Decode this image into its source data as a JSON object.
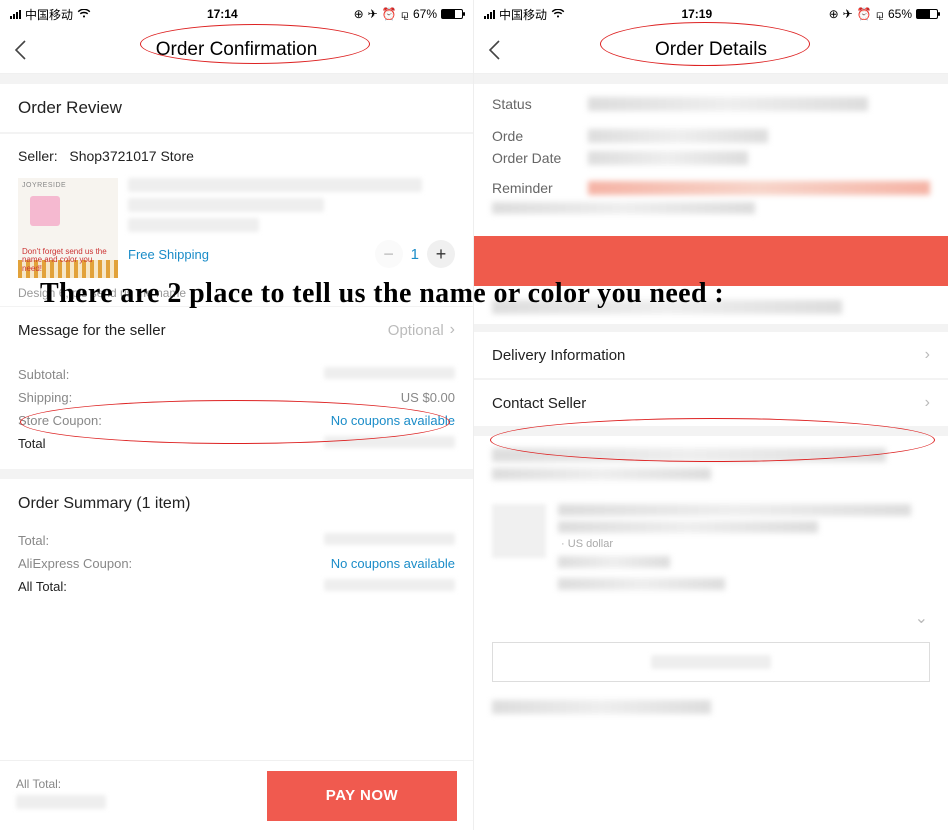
{
  "overlay_text": "There are 2 place to tell us the name or color you need :",
  "left": {
    "status": {
      "carrier": "中国移动",
      "time": "17:14",
      "battery_pct": "67%",
      "battery_fill": 67
    },
    "nav_title": "Order Confirmation",
    "review_title": "Order Review",
    "seller_label": "Seller:",
    "seller_name": "Shop3721017 Store",
    "thumb_brand": "JOYRESIDE",
    "thumb_hint": "Don't forget send us the name and color you need!",
    "free_shipping": "Free Shipping",
    "qty": "1",
    "variant_hint": "Design 6, pls send us the name",
    "msg_seller_label": "Message for the seller",
    "msg_seller_placeholder": "Optional",
    "subtotal_label": "Subtotal:",
    "shipping_label": "Shipping:",
    "shipping_value": "US $0.00",
    "coupon_label": "Store Coupon:",
    "coupon_value": "No coupons available",
    "total_label": "Total",
    "summary_title": "Order Summary (1 item)",
    "sum_total_label": "Total:",
    "sum_coupon_label": "AliExpress Coupon:",
    "sum_coupon_value": "No coupons available",
    "sum_alltotal_label": "All Total:",
    "bottom_alltotal_label": "All Total:",
    "pay_button": "PAY NOW"
  },
  "right": {
    "status": {
      "carrier": "中国移动",
      "time": "17:19",
      "battery_pct": "65%",
      "battery_fill": 65
    },
    "nav_title": "Order Details",
    "status_label": "Status",
    "order_label": "Orde",
    "orderdate_label": "Order Date",
    "reminder_label": "Reminder",
    "delivery_info": "Delivery Information",
    "contact_seller": "Contact Seller",
    "currency_hint": "US dollar"
  }
}
